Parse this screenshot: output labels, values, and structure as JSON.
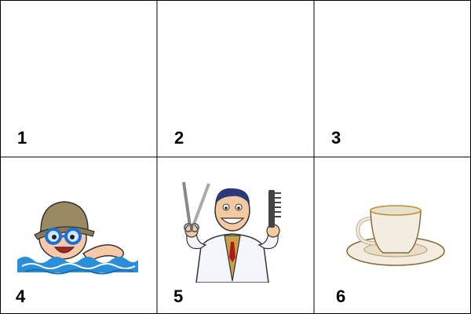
{
  "cells": [
    {
      "number": "1",
      "picture": "empty"
    },
    {
      "number": "2",
      "picture": "empty"
    },
    {
      "number": "3",
      "picture": "empty"
    },
    {
      "number": "4",
      "picture": "swimming-boy"
    },
    {
      "number": "5",
      "picture": "barber"
    },
    {
      "number": "6",
      "picture": "tea-cup"
    }
  ],
  "colors": {
    "grid_line": "#000000",
    "water": "#2a8fd8",
    "goggles": "#1f6fd0",
    "hat": "#9a8a62",
    "coat": "#f2f6fa",
    "cup": "#f3ece0"
  }
}
